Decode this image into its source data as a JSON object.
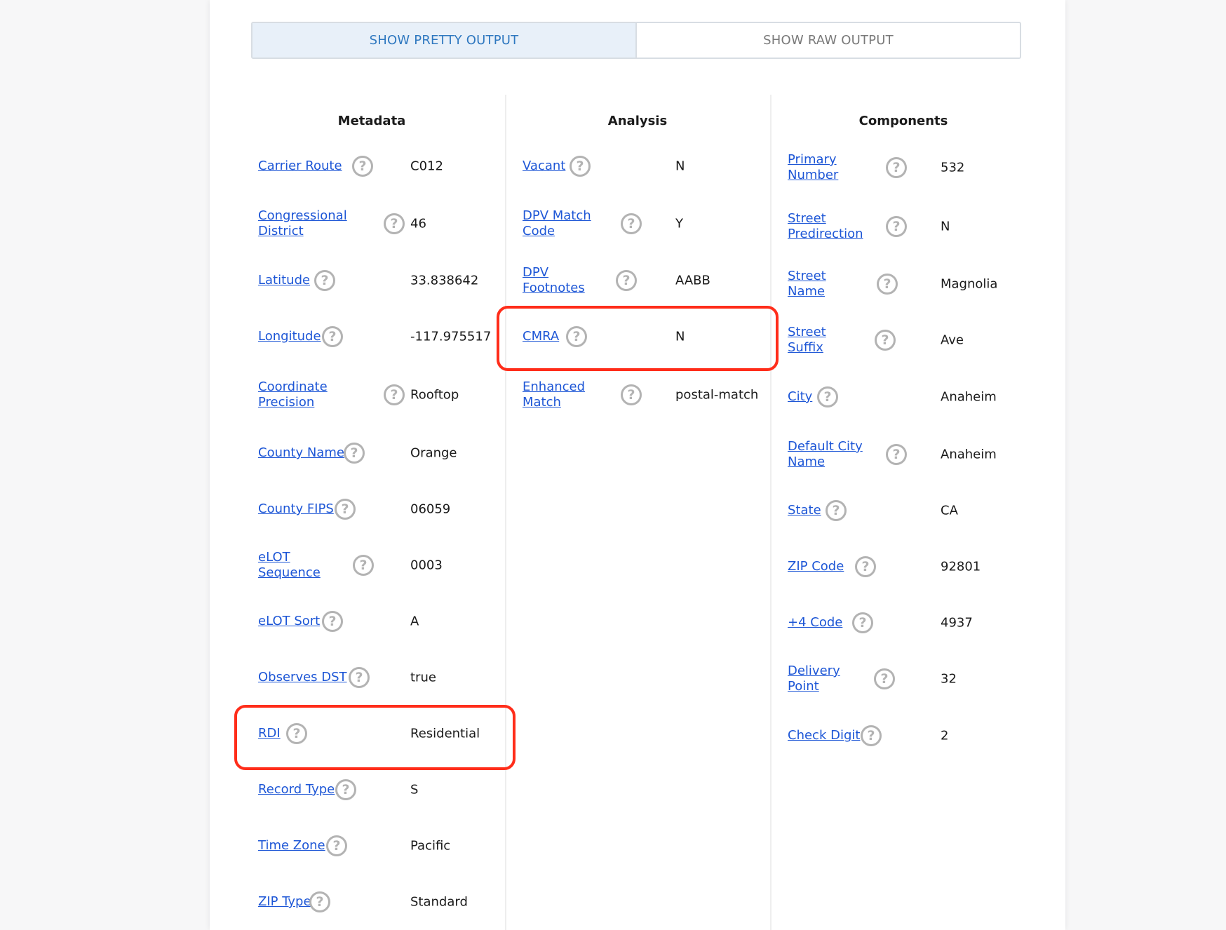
{
  "toggle": {
    "pretty_label": "SHOW PRETTY OUTPUT",
    "raw_label": "SHOW RAW OUTPUT"
  },
  "columns": {
    "metadata": {
      "title": "Metadata",
      "rows": [
        {
          "label": "Carrier Route",
          "value": "C012"
        },
        {
          "label": "Congressional District",
          "value": "46"
        },
        {
          "label": "Latitude",
          "value": "33.838642"
        },
        {
          "label": "Longitude",
          "value": "-117.975517"
        },
        {
          "label": "Coordinate Precision",
          "value": "Rooftop"
        },
        {
          "label": "County Name",
          "value": "Orange"
        },
        {
          "label": "County FIPS",
          "value": "06059"
        },
        {
          "label": "eLOT Sequence",
          "value": "0003"
        },
        {
          "label": "eLOT Sort",
          "value": "A"
        },
        {
          "label": "Observes DST",
          "value": "true"
        },
        {
          "label": "RDI",
          "value": "Residential"
        },
        {
          "label": "Record Type",
          "value": "S"
        },
        {
          "label": "Time Zone",
          "value": "Pacific"
        },
        {
          "label": "ZIP Type",
          "value": "Standard"
        }
      ]
    },
    "analysis": {
      "title": "Analysis",
      "rows": [
        {
          "label": "Vacant",
          "value": "N"
        },
        {
          "label": "DPV Match Code",
          "value": "Y"
        },
        {
          "label": "DPV Footnotes",
          "value": "AABB"
        },
        {
          "label": "CMRA",
          "value": "N"
        },
        {
          "label": "Enhanced Match",
          "value": "postal-match"
        }
      ]
    },
    "components": {
      "title": "Components",
      "rows": [
        {
          "label": "Primary Number",
          "value": "532"
        },
        {
          "label": "Street Predirection",
          "value": "N"
        },
        {
          "label": "Street Name",
          "value": "Magnolia"
        },
        {
          "label": "Street Suffix",
          "value": "Ave"
        },
        {
          "label": "City",
          "value": "Anaheim"
        },
        {
          "label": "Default City Name",
          "value": "Anaheim"
        },
        {
          "label": "State",
          "value": "CA"
        },
        {
          "label": "ZIP Code",
          "value": "92801"
        },
        {
          "label": "+4 Code",
          "value": "4937"
        },
        {
          "label": "Delivery Point",
          "value": "32"
        },
        {
          "label": "Check Digit",
          "value": "2"
        }
      ]
    }
  },
  "help_icon_glyph": "?",
  "colors": {
    "link": "#1d56d6",
    "active_tab_bg": "#e8f0f9",
    "active_tab_text": "#2f78c0",
    "highlight": "#ff2d1a",
    "help_icon": "#b3b3b3"
  }
}
